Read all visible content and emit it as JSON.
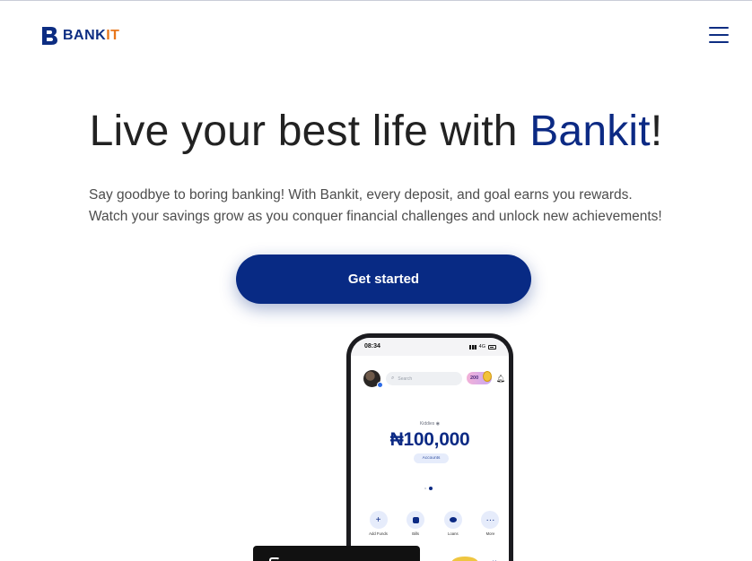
{
  "brand": {
    "name_main": "BANK",
    "name_accent": "IT",
    "primary_color": "#0c2a84",
    "accent_color": "#e8771c"
  },
  "header": {
    "menu_icon": "hamburger-menu-icon"
  },
  "hero": {
    "title_start": "Live your best life with ",
    "title_brand": "Bankit",
    "title_end": "!",
    "subtitle_line1": "Say goodbye to boring banking! With Bankit, every deposit, and goal earns you rewards.",
    "subtitle_line2": "Watch your savings grow as you conquer financial challenges and unlock new achievements!",
    "cta_label": "Get started"
  },
  "phone": {
    "time": "08:34",
    "network": "4G",
    "search_placeholder": "Search",
    "points": "200",
    "account_name": "Kiddies",
    "balance": "₦100,000",
    "accounts_label": "Accounts",
    "actions": [
      {
        "label": "Add Funds",
        "icon": "plus-icon",
        "glyph": "+"
      },
      {
        "label": "Bills",
        "icon": "bills-icon",
        "glyph": ""
      },
      {
        "label": "Loans",
        "icon": "loans-icon",
        "glyph": ""
      },
      {
        "label": "More",
        "icon": "more-icon",
        "glyph": "···"
      }
    ]
  }
}
